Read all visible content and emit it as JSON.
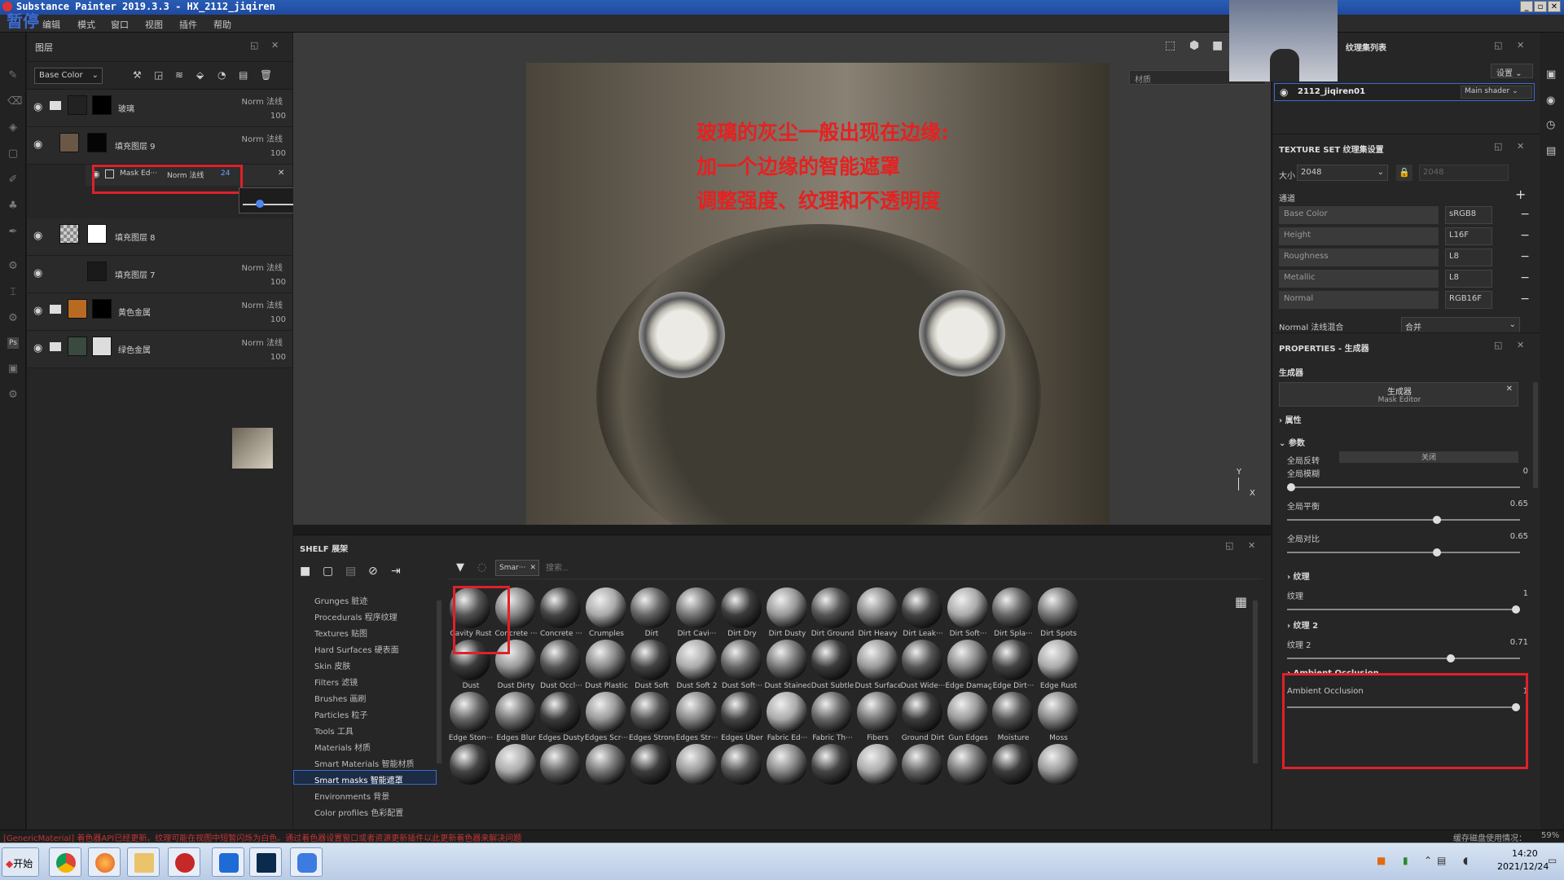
{
  "window": {
    "title": "Substance Painter 2019.3.3 - HX_2112_jiqiren",
    "overlay_pause": "暂停"
  },
  "menu": [
    "编辑",
    "模式",
    "窗口",
    "视图",
    "插件",
    "帮助"
  ],
  "layers_panel": {
    "title": "图层",
    "channel_select": "Base Color",
    "rows": [
      {
        "name": "玻璃",
        "blend": "Norm 法线",
        "opacity": "100"
      },
      {
        "name": "填充图层 9",
        "blend": "Norm 法线",
        "opacity": "100"
      },
      {
        "name": "填充图层 8",
        "blend": "",
        "opacity": ""
      },
      {
        "name": "填充图层 7",
        "blend": "Norm 法线",
        "opacity": "100"
      },
      {
        "name": "黄色金属",
        "blend": "Norm 法线",
        "opacity": "100"
      },
      {
        "name": "绿色金属",
        "blend": "Norm 法线",
        "opacity": "100"
      }
    ],
    "mask_row": {
      "name": "Mask Ed···",
      "blend": "Norm 法线",
      "opacity": "24"
    },
    "opacity_popup_value": "24"
  },
  "viewport": {
    "material_field": "材质",
    "annotation_lines": [
      "玻璃的灰尘一般出现在边缘:",
      "加一个边缘的智能遮罩",
      "调整强度、纹理和不透明度"
    ],
    "axis_y": "Y",
    "axis_x": "X"
  },
  "shelf": {
    "title": "SHELF 展架",
    "tab_label": "Smar···",
    "search_placeholder": "搜索...",
    "categories": [
      "Grunges 脏迹",
      "Procedurals 程序纹理",
      "Textures 贴图",
      "Hard Surfaces 硬表面",
      "Skin 皮肤",
      "Filters 滤镜",
      "Brushes 画刷",
      "Particles 粒子",
      "Tools 工具",
      "Materials 材质",
      "Smart Materials 智能材质",
      "Smart masks 智能遮罩",
      "Environments 背景",
      "Color profiles 色彩配置"
    ],
    "selected_category": "Smart masks 智能遮罩",
    "items": [
      "Cavity Rust",
      "Concrete ···",
      "Concrete ···",
      "Crumples",
      "Dirt",
      "Dirt Cavi···",
      "Dirt Dry",
      "Dirt Dusty",
      "Dirt Ground",
      "Dirt Heavy",
      "Dirt Leak···",
      "Dirt Soft···",
      "Dirt Spla···",
      "Dirt Spots",
      "Dust",
      "Dust Dirty",
      "Dust Occl···",
      "Dust Plastic",
      "Dust Soft",
      "Dust Soft 2",
      "Dust Soft···",
      "Dust Stained",
      "Dust Subtle",
      "Dust Surface",
      "Dust Wide···",
      "Edge Damage",
      "Edge Dirt···",
      "Edge Rust",
      "Edge Ston···",
      "Edges Blur",
      "Edges Dusty",
      "Edges Scr···",
      "Edges Strong",
      "Edges Str···",
      "Edges Uber",
      "Fabric Ed···",
      "Fabric Th···",
      "Fibers",
      "Ground Dirt",
      "Gun Edges",
      "Moisture",
      "Moss",
      "",
      "",
      "",
      "",
      "",
      "",
      "",
      "",
      "",
      "",
      "",
      "",
      "",
      ""
    ]
  },
  "texture_set_list": {
    "title": "纹理集列表",
    "settings_button": "设置",
    "item_name": "2112_jiqiren01",
    "shader": "Main shader"
  },
  "texture_set_settings": {
    "title": "TEXTURE SET 纹理集设置",
    "size_label": "大小",
    "size_value": "2048",
    "size_locked_value": "2048",
    "channels_label": "通道",
    "channels": [
      {
        "name": "Base Color",
        "format": "sRGB8"
      },
      {
        "name": "Height",
        "format": "L16F"
      },
      {
        "name": "Roughness",
        "format": "L8"
      },
      {
        "name": "Metallic",
        "format": "L8"
      },
      {
        "name": "Normal",
        "format": "RGB16F"
      }
    ],
    "normal_mix_label": "Normal 法线混合",
    "normal_mix_value": "合并"
  },
  "properties": {
    "title": "PROPERTIES - 生成器",
    "generator_label": "生成器",
    "generator_name": "生成器",
    "generator_sub": "Mask Editor",
    "attributes": "属性",
    "params": "参数",
    "global_invert_label": "全局反转",
    "global_invert_value": "关闭",
    "sliders_global": [
      {
        "label": "全局模糊",
        "value": "0",
        "fraction": 0.0
      },
      {
        "label": "全局平衡",
        "value": "0.65",
        "fraction": 0.65
      },
      {
        "label": "全局对比",
        "value": "0.65",
        "fraction": 0.65
      }
    ],
    "texture_section": "纹理",
    "texture_slider": {
      "label": "纹理",
      "value": "1",
      "fraction": 1.0
    },
    "texture2_section": "纹理 2",
    "texture2_slider": {
      "label": "纹理 2",
      "value": "0.71",
      "fraction": 0.71
    },
    "ao_section": "Ambient Occlusion",
    "ao_slider": {
      "label": "Ambient Occlusion",
      "value": "1",
      "fraction": 1.0
    }
  },
  "status": {
    "message": "[GenericMaterial] 着色器API已经更新。纹理可能在视图中短暂闪烁为白色。通过着色器设置窗口或者资源更新插件以此更新着色器来解决问题",
    "cache_label": "缓存磁盘使用情况：",
    "cache_value": "59%"
  },
  "taskbar": {
    "start": "开始",
    "time": "14:20",
    "date": "2021/12/24"
  }
}
